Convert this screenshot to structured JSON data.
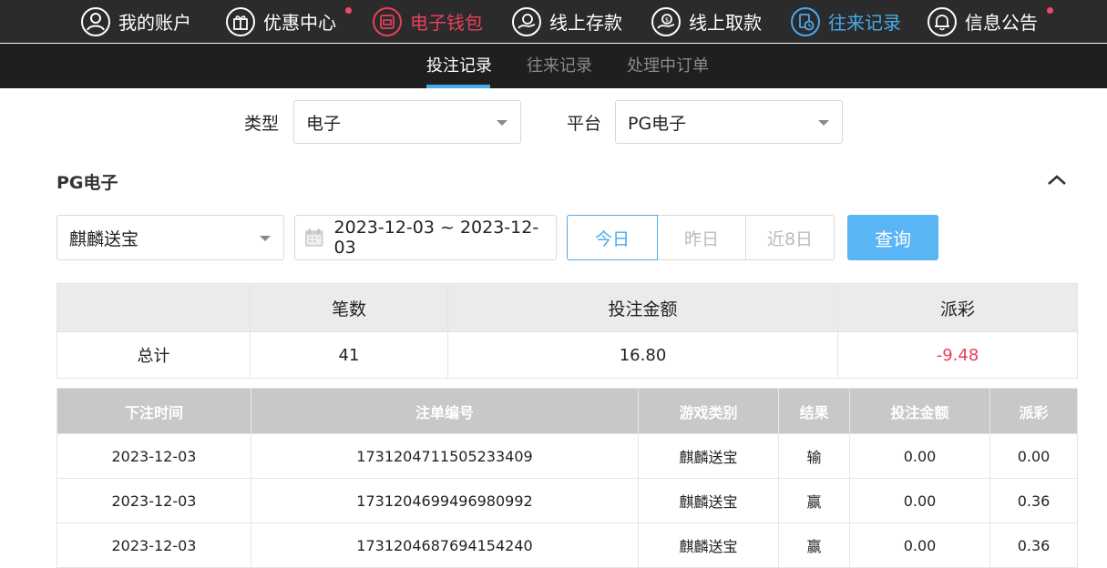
{
  "nav": {
    "items": [
      {
        "label": "我的账户",
        "icon": "user-icon"
      },
      {
        "label": "优惠中心",
        "icon": "gift-icon",
        "badge": true
      },
      {
        "label": "电子钱包",
        "icon": "wallet-icon"
      },
      {
        "label": "线上存款",
        "icon": "deposit-icon"
      },
      {
        "label": "线上取款",
        "icon": "withdraw-icon"
      },
      {
        "label": "往来记录",
        "icon": "records-icon"
      },
      {
        "label": "信息公告",
        "icon": "bell-icon",
        "badge": true
      }
    ],
    "colors": {
      "active_red": "#e8405a",
      "active_blue": "#4aa9ec",
      "badge": "#f04a6b"
    }
  },
  "subnav": {
    "tabs": [
      "投注记录",
      "往来记录",
      "处理中订单"
    ]
  },
  "filters": {
    "type_label": "类型",
    "type_value": "电子",
    "platform_label": "平台",
    "platform_value": "PG电子"
  },
  "section": {
    "title": "PG电子"
  },
  "query": {
    "game_value": "麒麟送宝",
    "date_range": "2023-12-03 ~ 2023-12-03",
    "quick_buttons": [
      "今日",
      "昨日",
      "近8日"
    ],
    "search_label": "查询"
  },
  "summary": {
    "headers": [
      "",
      "笔数",
      "投注金额",
      "派彩"
    ],
    "row_label": "总计",
    "count": "41",
    "bet_amount": "16.80",
    "payout": "-9.48"
  },
  "records": {
    "headers": [
      "下注时间",
      "注单编号",
      "游戏类别",
      "结果",
      "投注金额",
      "派彩"
    ],
    "rows": [
      [
        "2023-12-03",
        "1731204711505233409",
        "麒麟送宝",
        "输",
        "0.00",
        "0.00"
      ],
      [
        "2023-12-03",
        "1731204699496980992",
        "麒麟送宝",
        "赢",
        "0.00",
        "0.36"
      ],
      [
        "2023-12-03",
        "1731204687694154240",
        "麒麟送宝",
        "赢",
        "0.00",
        "0.36"
      ]
    ]
  }
}
